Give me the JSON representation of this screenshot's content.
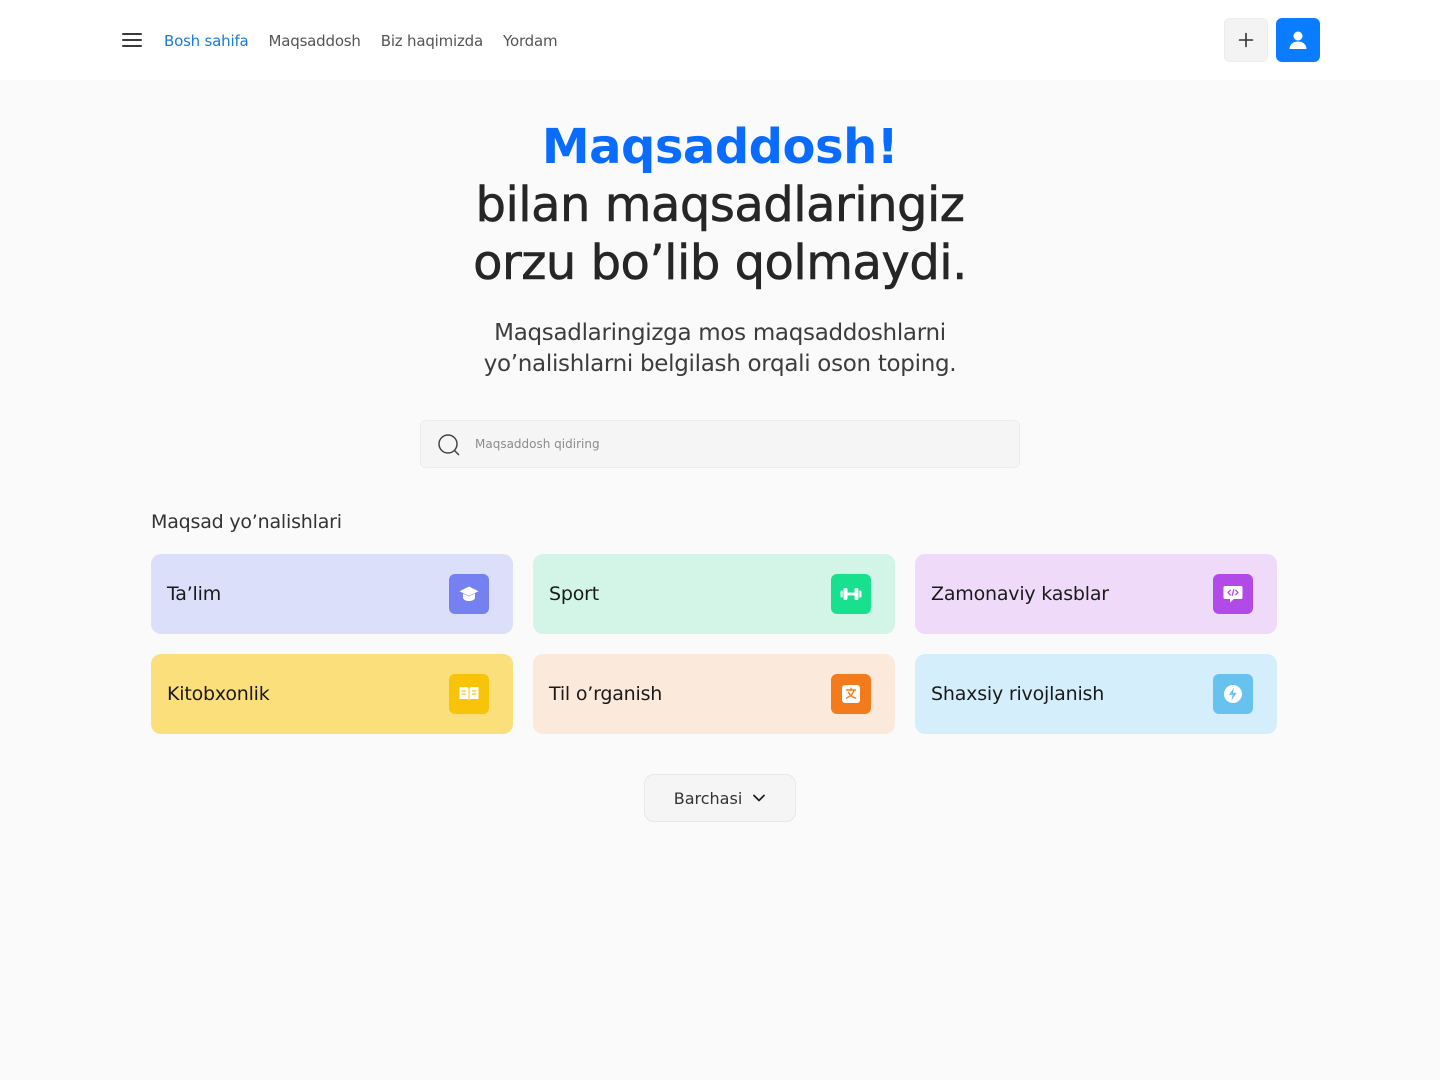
{
  "header": {
    "nav": [
      {
        "label": "Bosh sahifa",
        "active": true
      },
      {
        "label": "Maqsaddosh",
        "active": false
      },
      {
        "label": "Biz haqimizda",
        "active": false
      },
      {
        "label": "Yordam",
        "active": false
      }
    ],
    "icons": {
      "menu": "hamburger-menu-icon",
      "add": "plus-icon",
      "user": "user-icon"
    },
    "accent_color": "#0a7cff"
  },
  "hero": {
    "brand": "Maqsaddosh!",
    "line1": "bilan maqsadlaringiz",
    "line2": "orzu bo’lib qolmaydi.",
    "sub1": "Maqsadlaringizga mos maqsaddoshlarni",
    "sub2": "yo’nalishlarni belgilash orqali oson toping."
  },
  "search": {
    "placeholder": "Maqsaddosh qidiring",
    "value": "",
    "icon": "search-icon"
  },
  "categories": {
    "title": "Maqsad yo’nalishlari",
    "items": [
      {
        "label": "Ta’lim",
        "icon": "graduation-cap-icon",
        "bg": "#dcdffa",
        "icon_bg": "#7581f0"
      },
      {
        "label": "Sport",
        "icon": "dumbbell-icon",
        "bg": "#d3f5e7",
        "icon_bg": "#17e08e"
      },
      {
        "label": "Zamonaviy kasblar",
        "icon": "code-chat-icon",
        "bg": "#f0dafa",
        "icon_bg": "#b24ae8"
      },
      {
        "label": "Kitobxonlik",
        "icon": "book-icon",
        "bg": "#fadf7b",
        "icon_bg": "#f9c309"
      },
      {
        "label": "Til o’rganish",
        "icon": "translate-icon",
        "bg": "#fbe9dc",
        "icon_bg": "#f47b1c"
      },
      {
        "label": "Shaxsiy rivojlanish",
        "icon": "lightning-icon",
        "bg": "#d5eefb",
        "icon_bg": "#67c2f0"
      }
    ]
  },
  "more_button": {
    "label": "Barchasi",
    "icon": "chevron-down-icon"
  }
}
